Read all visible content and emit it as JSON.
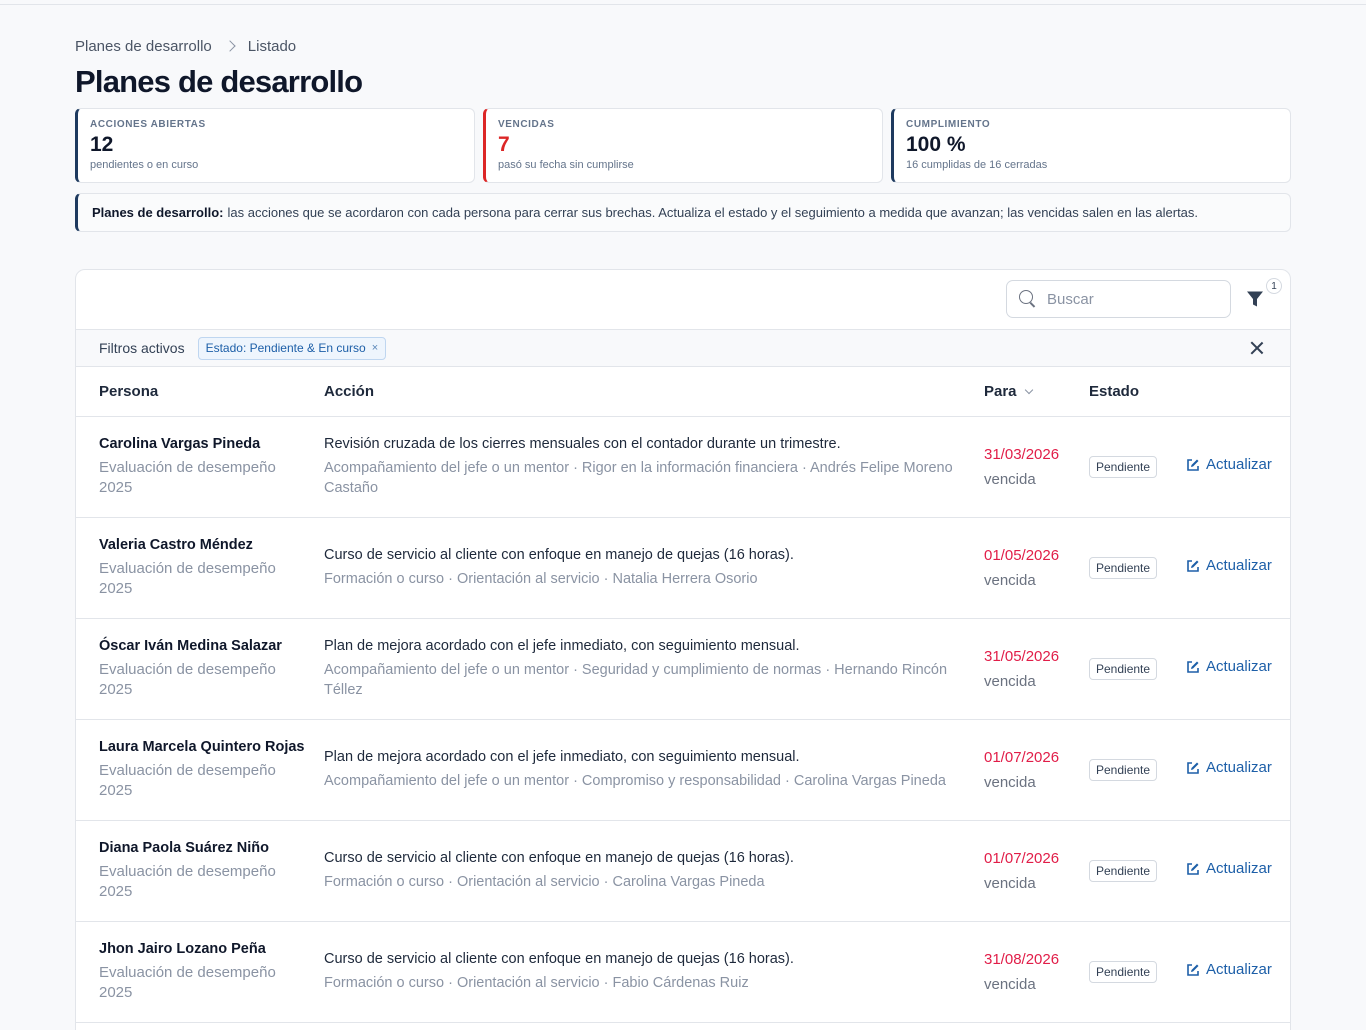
{
  "breadcrumb": {
    "root": "Planes de desarrollo",
    "current": "Listado"
  },
  "page_title": "Planes de desarrollo",
  "kpis": [
    {
      "label": "ACCIONES ABIERTAS",
      "value": "12",
      "sub": "pendientes o en curso"
    },
    {
      "label": "VENCIDAS",
      "value": "7",
      "sub": "pasó su fecha sin cumplirse"
    },
    {
      "label": "CUMPLIMIENTO",
      "value": "100 %",
      "sub": "16 cumplidas de 16 cerradas"
    }
  ],
  "info": {
    "title": "Planes de desarrollo:",
    "text": "las acciones que se acordaron con cada persona para cerrar sus brechas. Actualiza el estado y el seguimiento a medida que avanzan; las vencidas salen en las alertas."
  },
  "toolbar": {
    "search_placeholder": "Buscar",
    "filter_count": "1"
  },
  "active_filters": {
    "label": "Filtros activos",
    "chip": "Estado: Pendiente & En curso",
    "chip_remove": "×"
  },
  "columns": {
    "persona": "Persona",
    "accion": "Acción",
    "para": "Para",
    "estado": "Estado"
  },
  "rows": [
    {
      "name": "Carolina Vargas Pineda",
      "eval": "Evaluación de desempeño 2025",
      "action": "Revisión cruzada de los cierres mensuales con el contador durante un trimestre.",
      "meta": "Acompañamiento del jefe o un mentor · Rigor en la información financiera · Andrés Felipe Moreno Castaño",
      "date": "31/03/2026",
      "date_note": "vencida",
      "status": "Pendiente",
      "update": "Actualizar"
    },
    {
      "name": "Valeria Castro Méndez",
      "eval": "Evaluación de desempeño 2025",
      "action": "Curso de servicio al cliente con enfoque en manejo de quejas (16 horas).",
      "meta": "Formación o curso · Orientación al servicio · Natalia Herrera Osorio",
      "date": "01/05/2026",
      "date_note": "vencida",
      "status": "Pendiente",
      "update": "Actualizar"
    },
    {
      "name": "Óscar Iván Medina Salazar",
      "eval": "Evaluación de desempeño 2025",
      "action": "Plan de mejora acordado con el jefe inmediato, con seguimiento mensual.",
      "meta": "Acompañamiento del jefe o un mentor · Seguridad y cumplimiento de normas · Hernando Rincón Téllez",
      "date": "31/05/2026",
      "date_note": "vencida",
      "status": "Pendiente",
      "update": "Actualizar"
    },
    {
      "name": "Laura Marcela Quintero Rojas",
      "eval": "Evaluación de desempeño 2025",
      "action": "Plan de mejora acordado con el jefe inmediato, con seguimiento mensual.",
      "meta": "Acompañamiento del jefe o un mentor · Compromiso y responsabilidad · Carolina Vargas Pineda",
      "date": "01/07/2026",
      "date_note": "vencida",
      "status": "Pendiente",
      "update": "Actualizar"
    },
    {
      "name": "Diana Paola Suárez Niño",
      "eval": "Evaluación de desempeño 2025",
      "action": "Curso de servicio al cliente con enfoque en manejo de quejas (16 horas).",
      "meta": "Formación o curso · Orientación al servicio · Carolina Vargas Pineda",
      "date": "01/07/2026",
      "date_note": "vencida",
      "status": "Pendiente",
      "update": "Actualizar"
    },
    {
      "name": "Jhon Jairo Lozano Peña",
      "eval": "Evaluación de desempeño 2025",
      "action": "Curso de servicio al cliente con enfoque en manejo de quejas (16 horas).",
      "meta": "Formación o curso · Orientación al servicio · Fabio Cárdenas Ruiz",
      "date": "31/08/2026",
      "date_note": "vencida",
      "status": "Pendiente",
      "update": "Actualizar"
    }
  ],
  "colors": {
    "accent": "#1e3a5f",
    "danger": "#dc2626",
    "date_overdue": "#e11d48",
    "link": "#1d5fa8"
  }
}
